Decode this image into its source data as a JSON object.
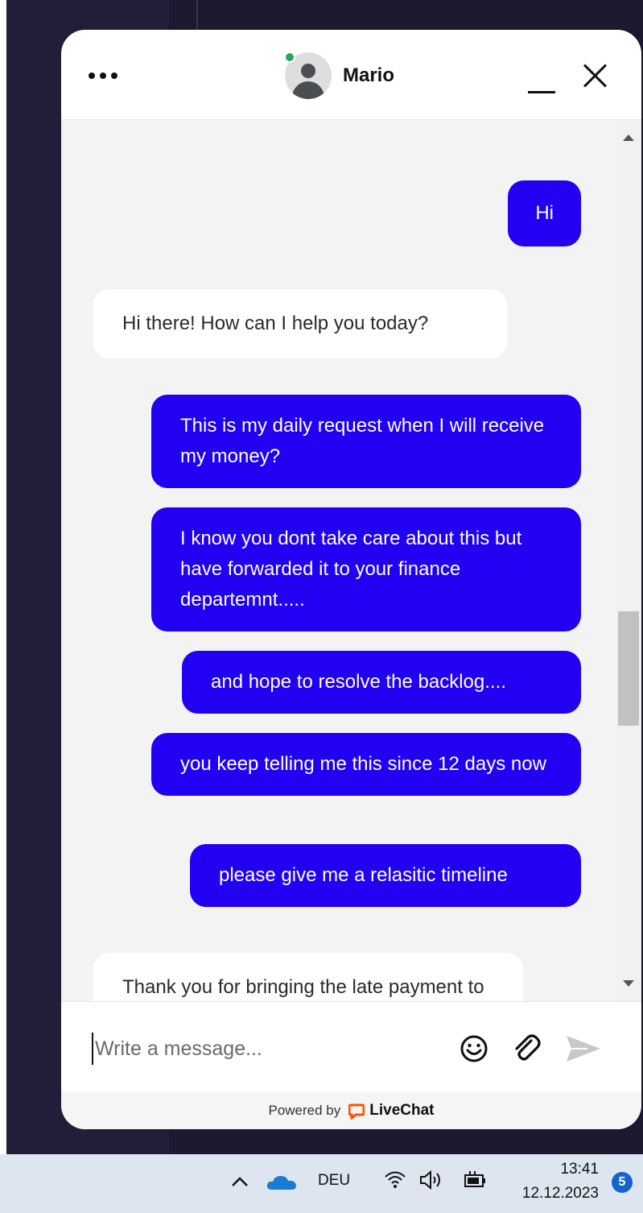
{
  "chat_header": {
    "agent_name": "Mario",
    "status_color": "#29a35a"
  },
  "messages": [
    {
      "direction": "out",
      "text": "Hi"
    },
    {
      "direction": "in",
      "text": "Hi there! How can I help you today?"
    },
    {
      "direction": "out",
      "text": "This is my daily request when I will receive my money?"
    },
    {
      "direction": "out",
      "text": "I know you dont take care about this but have forwarded it to your finance departemnt....."
    },
    {
      "direction": "out",
      "text": "and hope to resolve the backlog...."
    },
    {
      "direction": "out",
      "text": "you keep telling me this since 12 days now"
    },
    {
      "direction": "out",
      "text": "please give me a relasitic timeline"
    },
    {
      "direction": "in",
      "text": "Thank you for bringing the late payment to our attention. We're"
    }
  ],
  "composer": {
    "placeholder": "Write a message..."
  },
  "footer": {
    "powered_by": "Powered by",
    "brand": "LiveChat"
  },
  "taskbar": {
    "language": "DEU",
    "time": "13:41",
    "date": "12.12.2023",
    "notifications": "5"
  },
  "colors": {
    "outgoing_bubble": "#2200f2",
    "incoming_bubble": "#ffffff",
    "livechat_logo": "#ff5100"
  },
  "icons": [
    "menu-dots-icon",
    "avatar-icon",
    "minimize-icon",
    "close-icon",
    "emoji-icon",
    "paperclip-icon",
    "send-icon",
    "livechat-logo-icon",
    "chevron-up-icon",
    "onedrive-icon",
    "wifi-icon",
    "speaker-icon",
    "battery-icon"
  ]
}
